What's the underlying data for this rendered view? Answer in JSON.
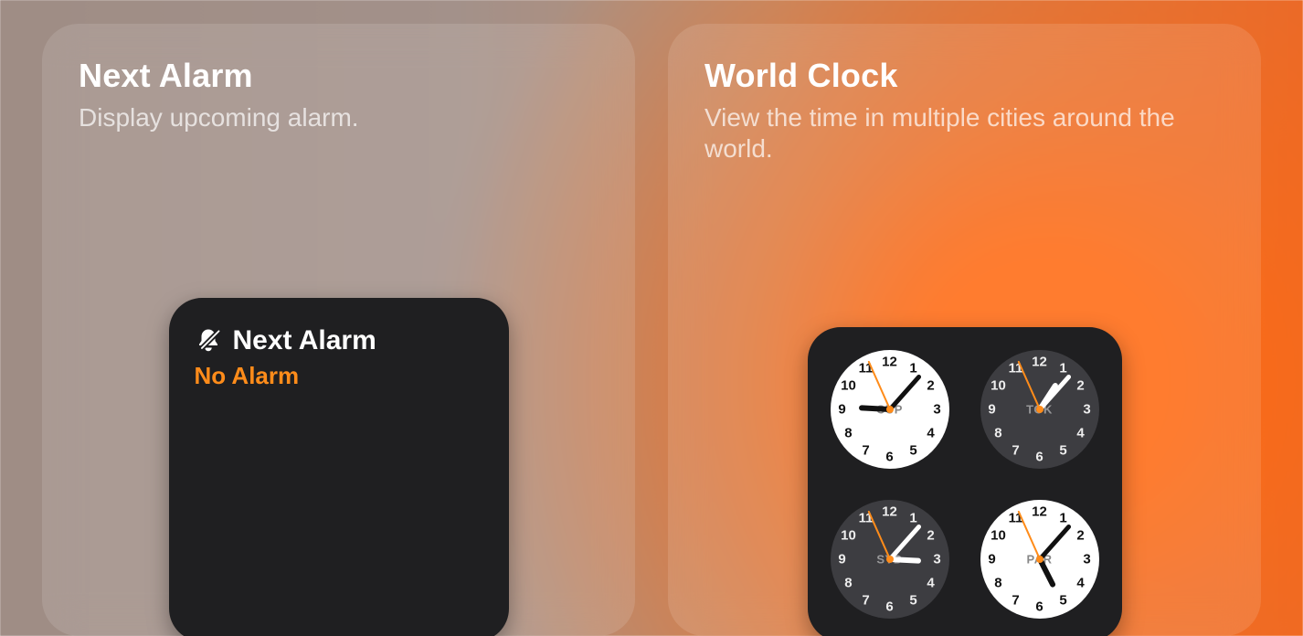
{
  "cards": {
    "next_alarm": {
      "title": "Next Alarm",
      "description": "Display upcoming alarm.",
      "widget": {
        "title": "Next Alarm",
        "status": "No Alarm"
      }
    },
    "world_clock": {
      "title": "World Clock",
      "description": "View the time in multiple cities around the world.",
      "clocks": [
        {
          "city": "CUP",
          "theme": "light",
          "hour": 9,
          "minute": 6,
          "second": 56
        },
        {
          "city": "TOK",
          "theme": "dark",
          "hour": 1,
          "minute": 6,
          "second": 56
        },
        {
          "city": "SYD",
          "theme": "dark",
          "hour": 3,
          "minute": 6,
          "second": 56
        },
        {
          "city": "PAR",
          "theme": "light",
          "hour": 5,
          "minute": 6,
          "second": 56
        }
      ]
    }
  },
  "colors": {
    "accent_orange": "#ff8c1a"
  }
}
